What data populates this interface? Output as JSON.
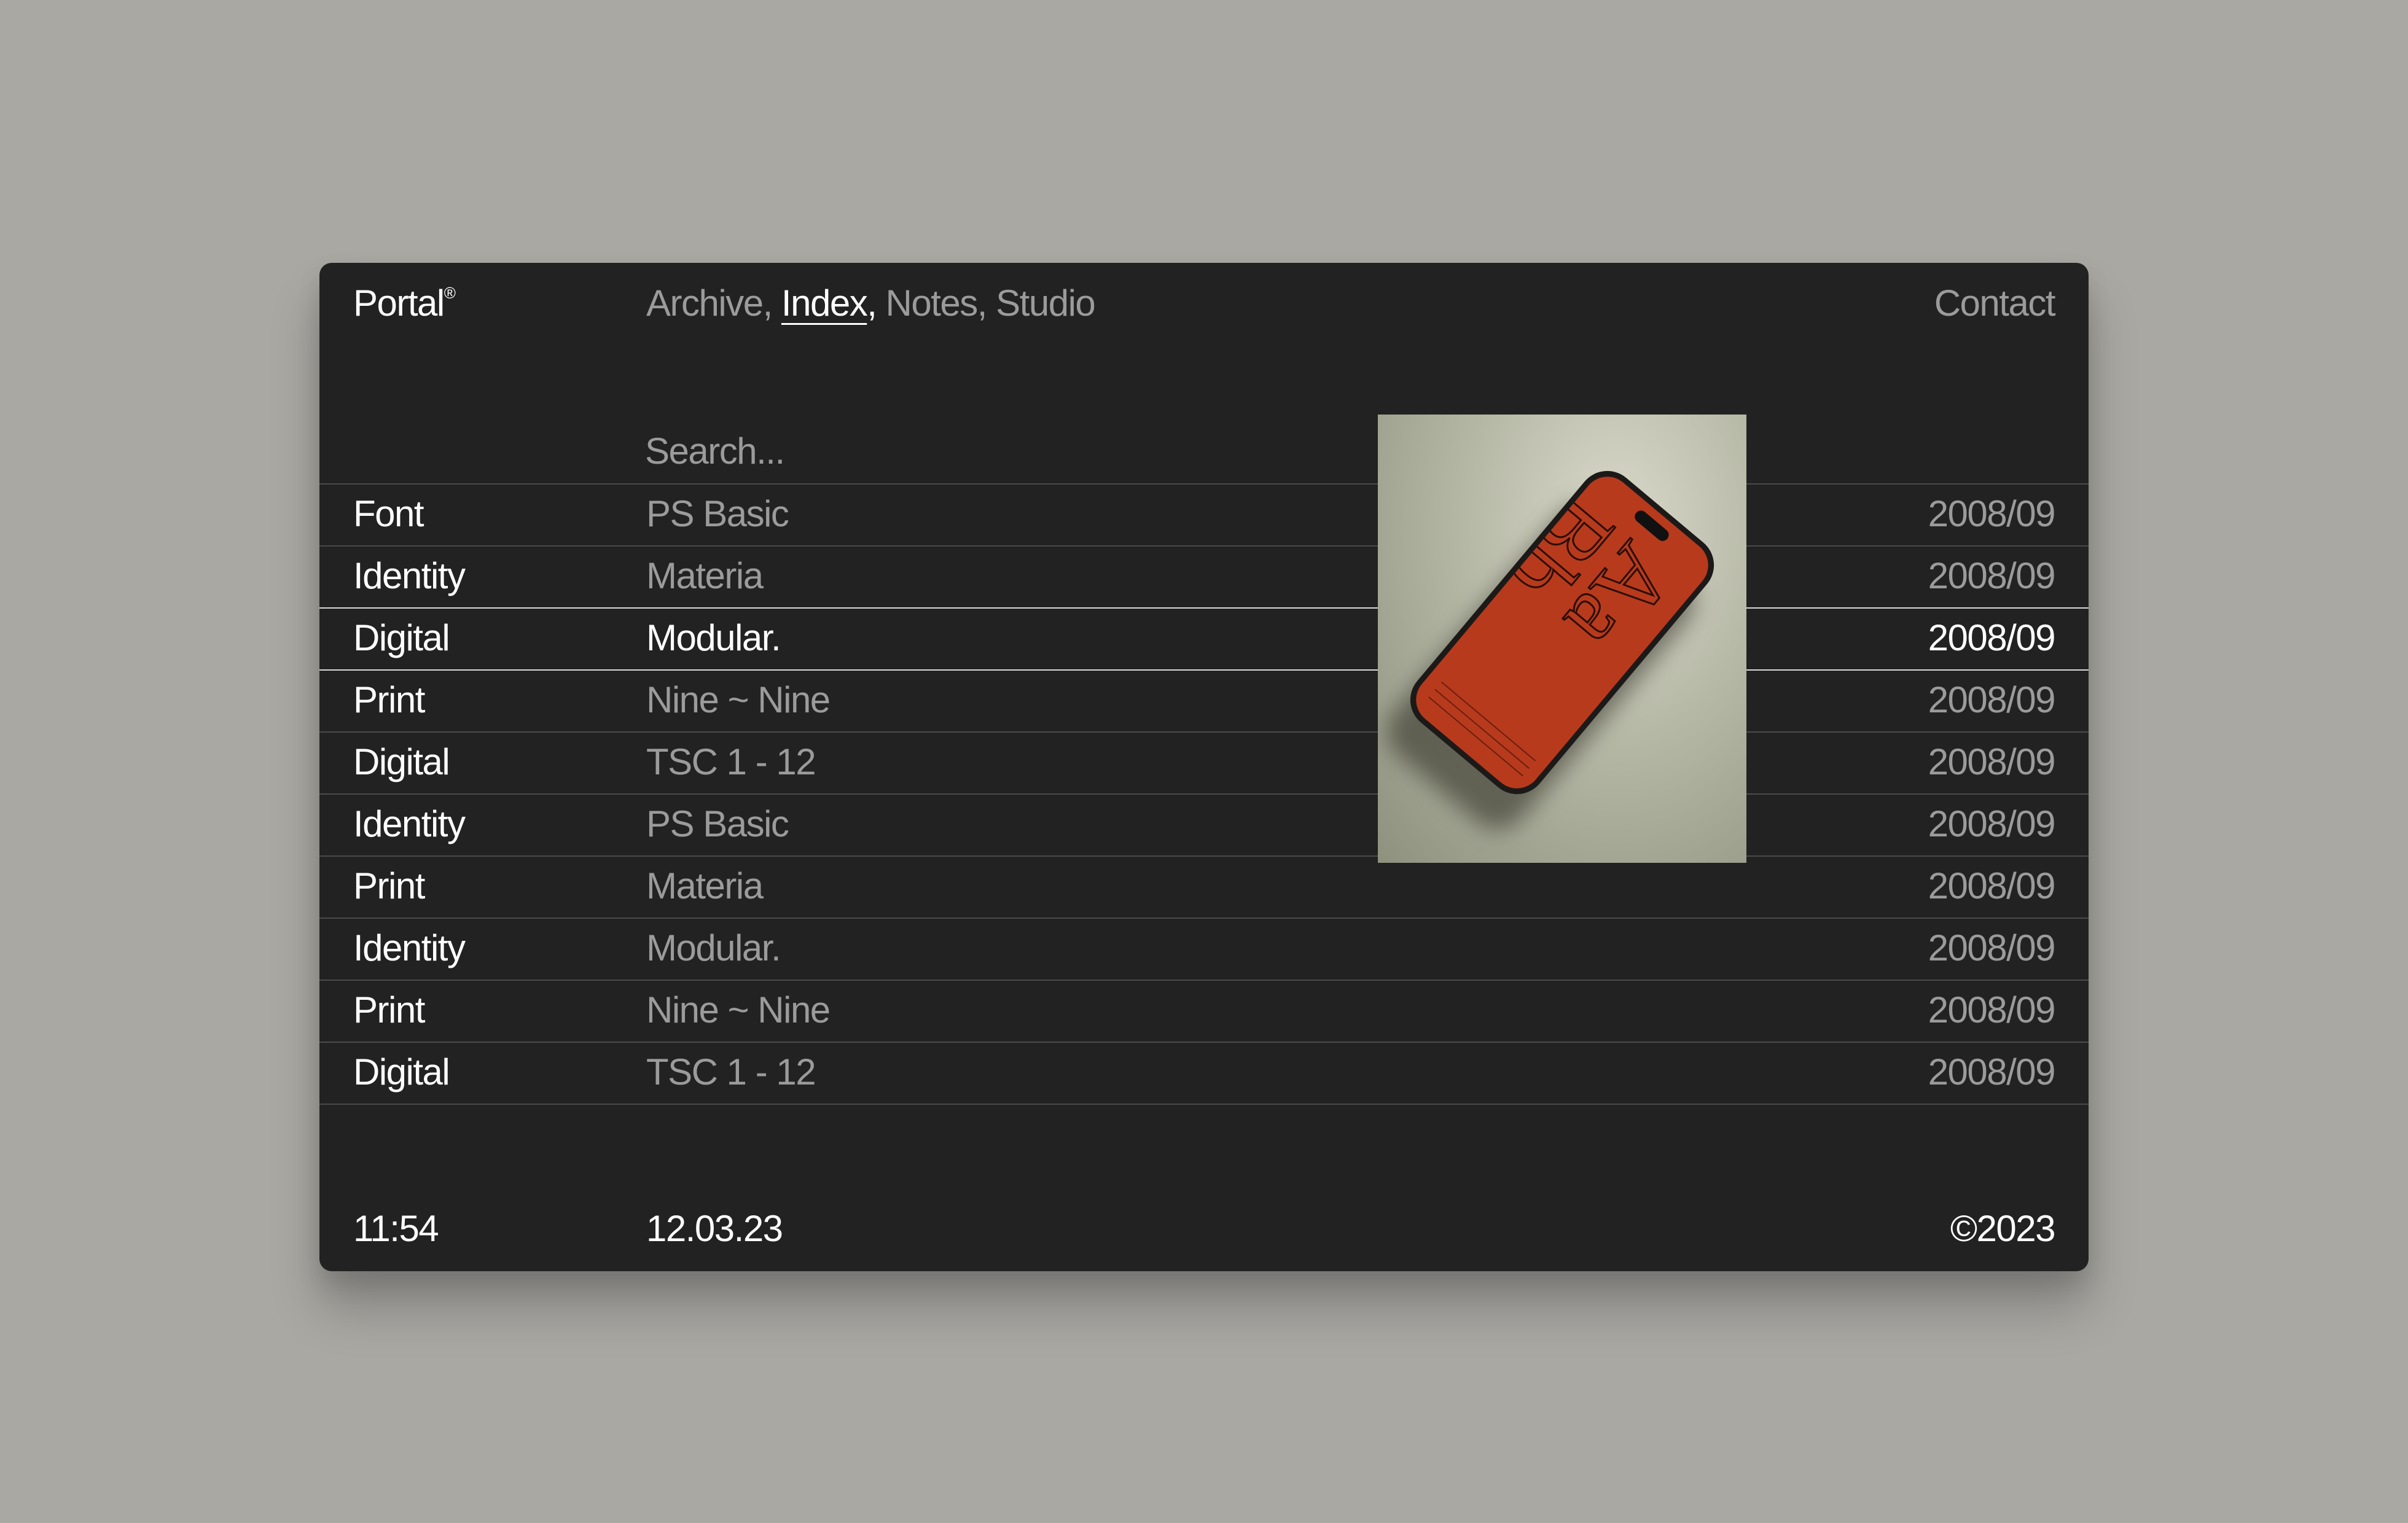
{
  "header": {
    "logo": "Portal",
    "logo_mark": "®",
    "nav": [
      {
        "label": "Archive",
        "sep": ", "
      },
      {
        "label": "Index",
        "sep": ", "
      },
      {
        "label": "Notes",
        "sep": ", "
      },
      {
        "label": "Studio",
        "sep": ""
      }
    ],
    "nav_active": "Index",
    "contact": "Contact"
  },
  "search": {
    "placeholder": "Search..."
  },
  "rows": [
    {
      "category": "Font",
      "name": "PS Basic",
      "date": "2008/09"
    },
    {
      "category": "Identity",
      "name": "Materia",
      "date": "2008/09"
    },
    {
      "category": "Digital",
      "name": "Modular.",
      "date": "2008/09"
    },
    {
      "category": "Print",
      "name": "Nine ~ Nine",
      "date": "2008/09"
    },
    {
      "category": "Digital",
      "name": "TSC 1 - 12",
      "date": "2008/09"
    },
    {
      "category": "Identity",
      "name": "PS Basic",
      "date": "2008/09"
    },
    {
      "category": "Print",
      "name": "Materia",
      "date": "2008/09"
    },
    {
      "category": "Identity",
      "name": "Modular.",
      "date": "2008/09"
    },
    {
      "category": "Print",
      "name": "Nine ~ Nine",
      "date": "2008/09"
    },
    {
      "category": "Digital",
      "name": "TSC 1 - 12",
      "date": "2008/09"
    }
  ],
  "active_row_index": 2,
  "preview": {
    "icon": "phone-mockup-image"
  },
  "footer": {
    "time": "11:54",
    "date": "12.03.23",
    "copyright": "©2023"
  },
  "colors": {
    "background": "#a9a8a3",
    "panel": "#222222",
    "text": "#ffffff",
    "muted": "#9b9b9b",
    "accent_screen": "#b83a1c"
  }
}
